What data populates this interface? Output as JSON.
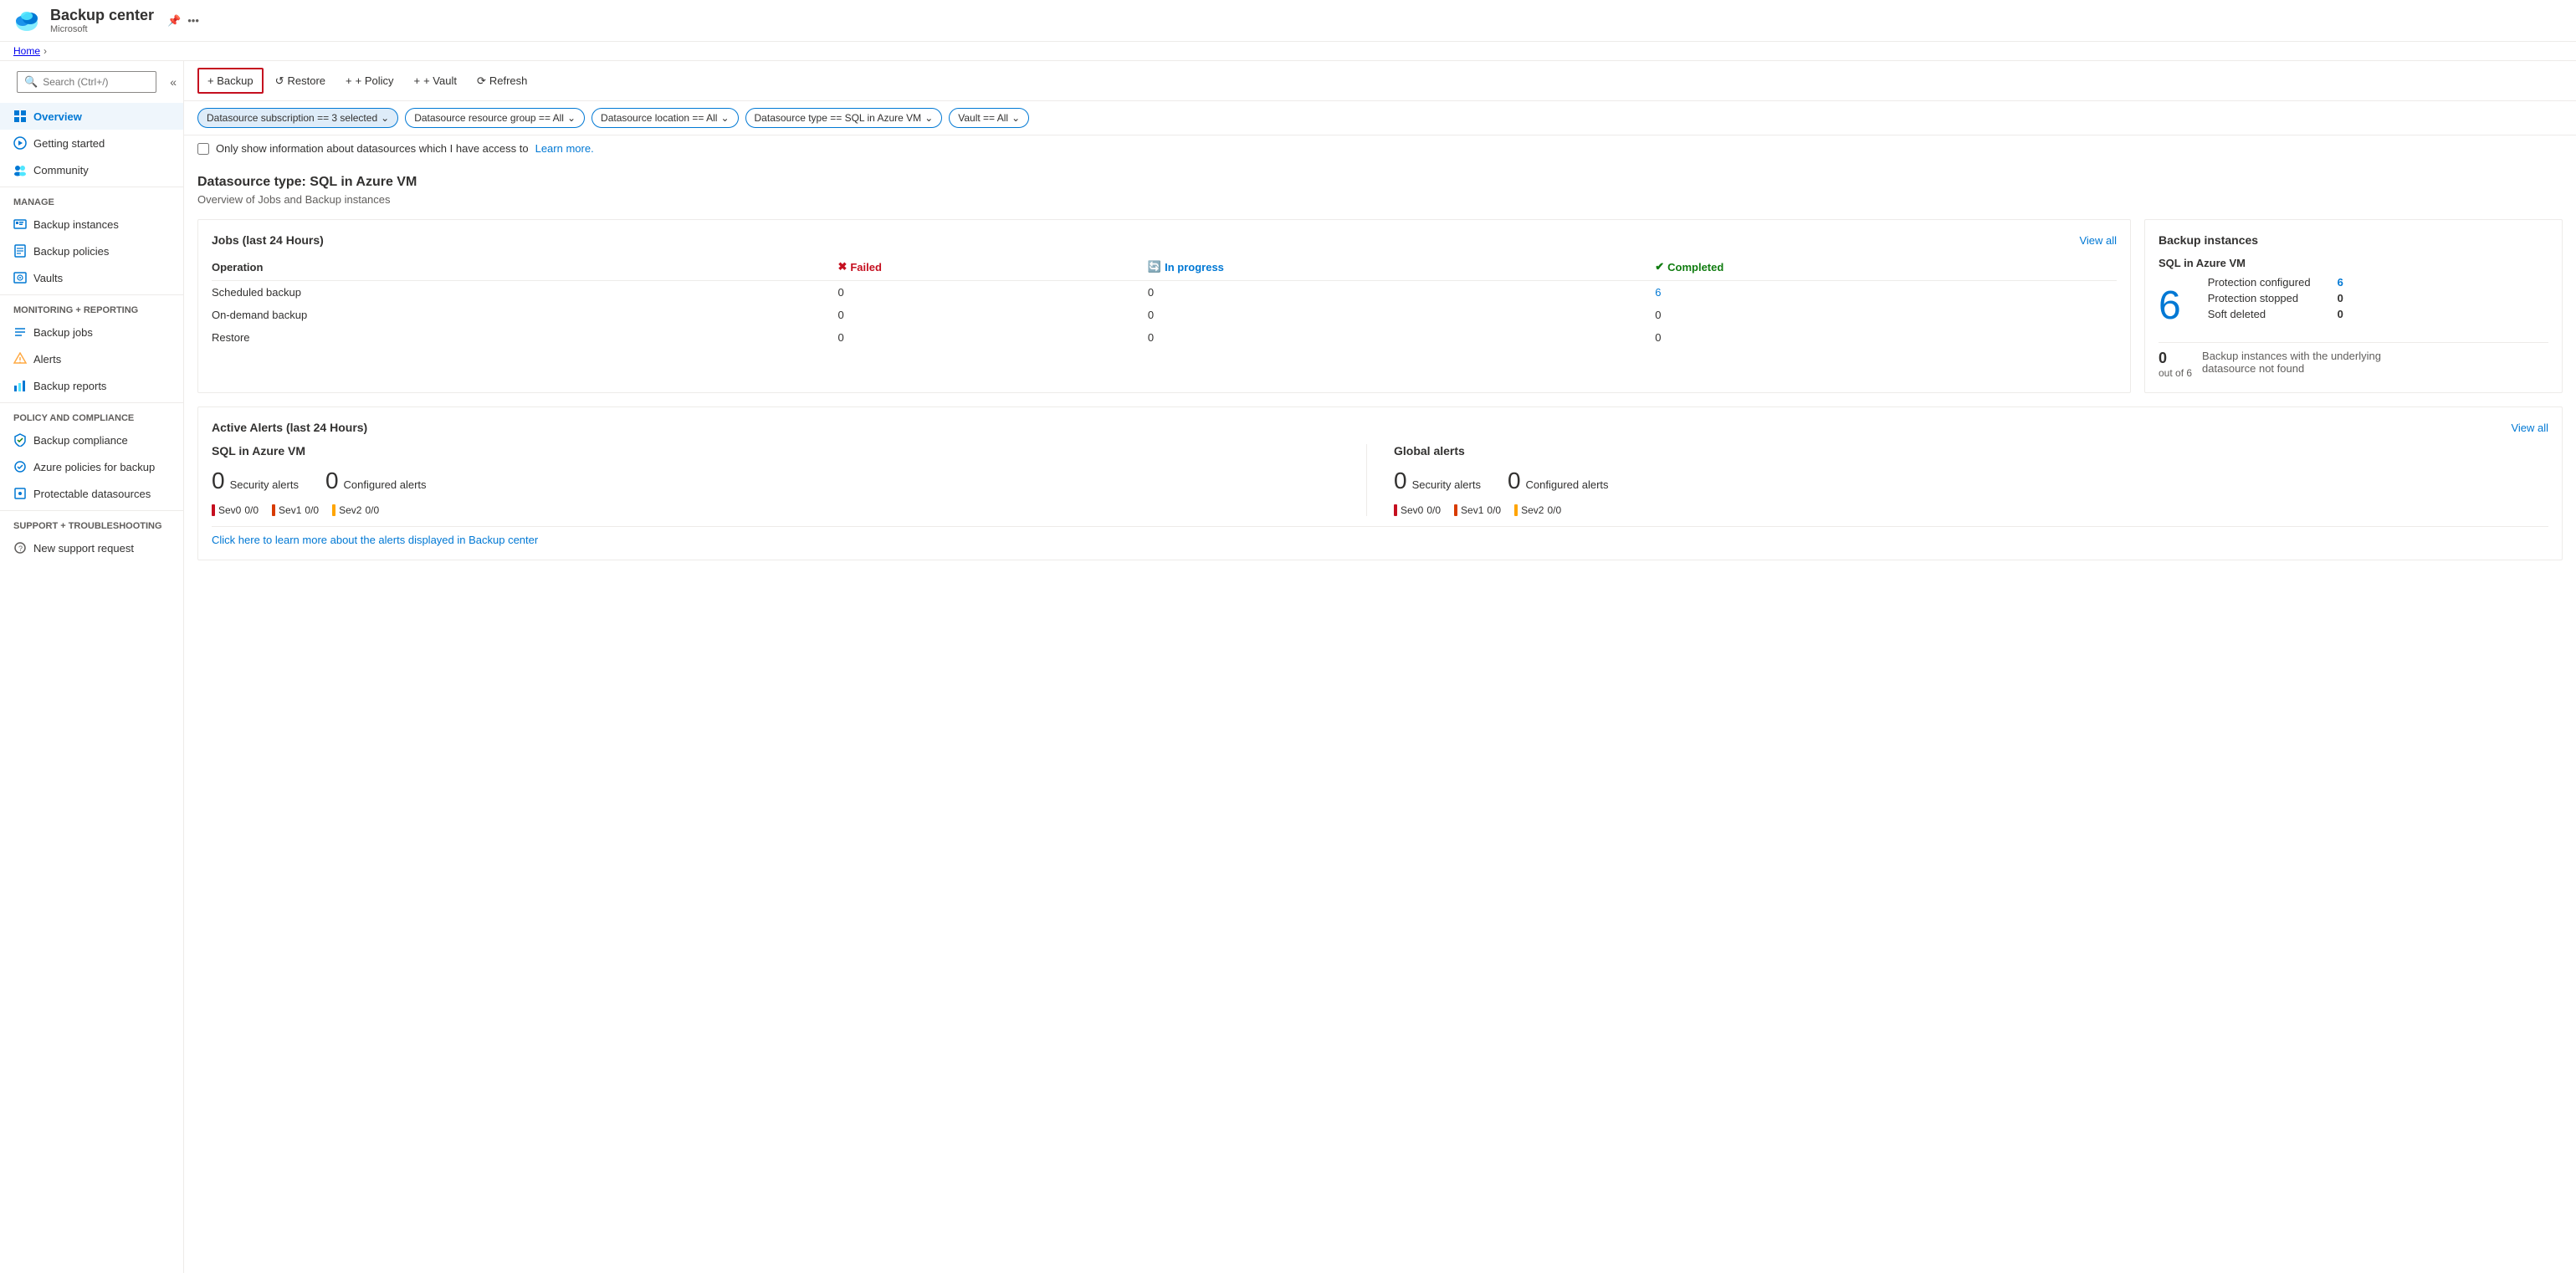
{
  "app": {
    "title": "Backup center",
    "subtitle": "Microsoft",
    "breadcrumb_home": "Home"
  },
  "toolbar": {
    "backup_label": "+ Backup",
    "restore_label": "Restore",
    "policy_label": "+ Policy",
    "vault_label": "+ Vault",
    "refresh_label": "Refresh"
  },
  "filters": {
    "subscription": "Datasource subscription == 3 selected",
    "resource_group": "Datasource resource group == All",
    "location": "Datasource location == All",
    "datasource_type": "Datasource type == SQL in Azure VM",
    "vault": "Vault == All"
  },
  "access_check": {
    "label": "Only show information about datasources which I have access to",
    "learn_more": "Learn more."
  },
  "content": {
    "datasource_title": "Datasource type: SQL in Azure VM",
    "datasource_subtitle": "Overview of Jobs and Backup instances"
  },
  "jobs_card": {
    "title": "Jobs (last 24 Hours)",
    "view_all": "View all",
    "col_operation": "Operation",
    "col_failed": "Failed",
    "col_inprogress": "In progress",
    "col_completed": "Completed",
    "rows": [
      {
        "operation": "Scheduled backup",
        "failed": "0",
        "inprogress": "0",
        "completed": "6"
      },
      {
        "operation": "On-demand backup",
        "failed": "0",
        "inprogress": "0",
        "completed": "0"
      },
      {
        "operation": "Restore",
        "failed": "0",
        "inprogress": "0",
        "completed": "0"
      }
    ]
  },
  "backup_instances_card": {
    "title": "Backup instances",
    "subtitle": "SQL in Azure VM",
    "big_number": "6",
    "protection_configured_label": "Protection configured",
    "protection_configured_value": "6",
    "protection_stopped_label": "Protection stopped",
    "protection_stopped_value": "0",
    "soft_deleted_label": "Soft deleted",
    "soft_deleted_value": "0",
    "bottom_count": "0",
    "bottom_out_of": "out of 6",
    "bottom_desc": "Backup instances with the underlying datasource not found"
  },
  "alerts_card": {
    "title": "Active Alerts (last 24 Hours)",
    "view_all": "View all",
    "sql_section": {
      "title": "SQL in Azure VM",
      "security_alerts_count": "0",
      "security_alerts_label": "Security alerts",
      "configured_alerts_count": "0",
      "configured_alerts_label": "Configured alerts",
      "sev0_label": "Sev0",
      "sev0_value": "0/0",
      "sev1_label": "Sev1",
      "sev1_value": "0/0",
      "sev2_label": "Sev2",
      "sev2_value": "0/0"
    },
    "global_section": {
      "title": "Global alerts",
      "security_alerts_count": "0",
      "security_alerts_label": "Security alerts",
      "configured_alerts_count": "0",
      "configured_alerts_label": "Configured alerts",
      "sev0_label": "Sev0",
      "sev0_value": "0/0",
      "sev1_label": "Sev1",
      "sev1_value": "0/0",
      "sev2_label": "Sev2",
      "sev2_value": "0/0"
    },
    "footer_link": "Click here to learn more about the alerts displayed in Backup center"
  },
  "sidebar": {
    "search_placeholder": "Search (Ctrl+/)",
    "nav_items": [
      {
        "id": "overview",
        "label": "Overview",
        "active": true
      },
      {
        "id": "getting-started",
        "label": "Getting started",
        "active": false
      },
      {
        "id": "community",
        "label": "Community",
        "active": false
      }
    ],
    "manage_label": "Manage",
    "manage_items": [
      {
        "id": "backup-instances",
        "label": "Backup instances",
        "active": false
      },
      {
        "id": "backup-policies",
        "label": "Backup policies",
        "active": false
      },
      {
        "id": "vaults",
        "label": "Vaults",
        "active": false
      }
    ],
    "monitoring_label": "Monitoring + reporting",
    "monitoring_items": [
      {
        "id": "backup-jobs",
        "label": "Backup jobs",
        "active": false
      },
      {
        "id": "alerts",
        "label": "Alerts",
        "active": false
      },
      {
        "id": "backup-reports",
        "label": "Backup reports",
        "active": false
      }
    ],
    "policy_label": "Policy and compliance",
    "policy_items": [
      {
        "id": "backup-compliance",
        "label": "Backup compliance",
        "active": false
      },
      {
        "id": "azure-policies",
        "label": "Azure policies for backup",
        "active": false
      },
      {
        "id": "protectable-datasources",
        "label": "Protectable datasources",
        "active": false
      }
    ],
    "support_label": "Support + troubleshooting",
    "support_items": [
      {
        "id": "new-support-request",
        "label": "New support request",
        "active": false
      }
    ]
  }
}
